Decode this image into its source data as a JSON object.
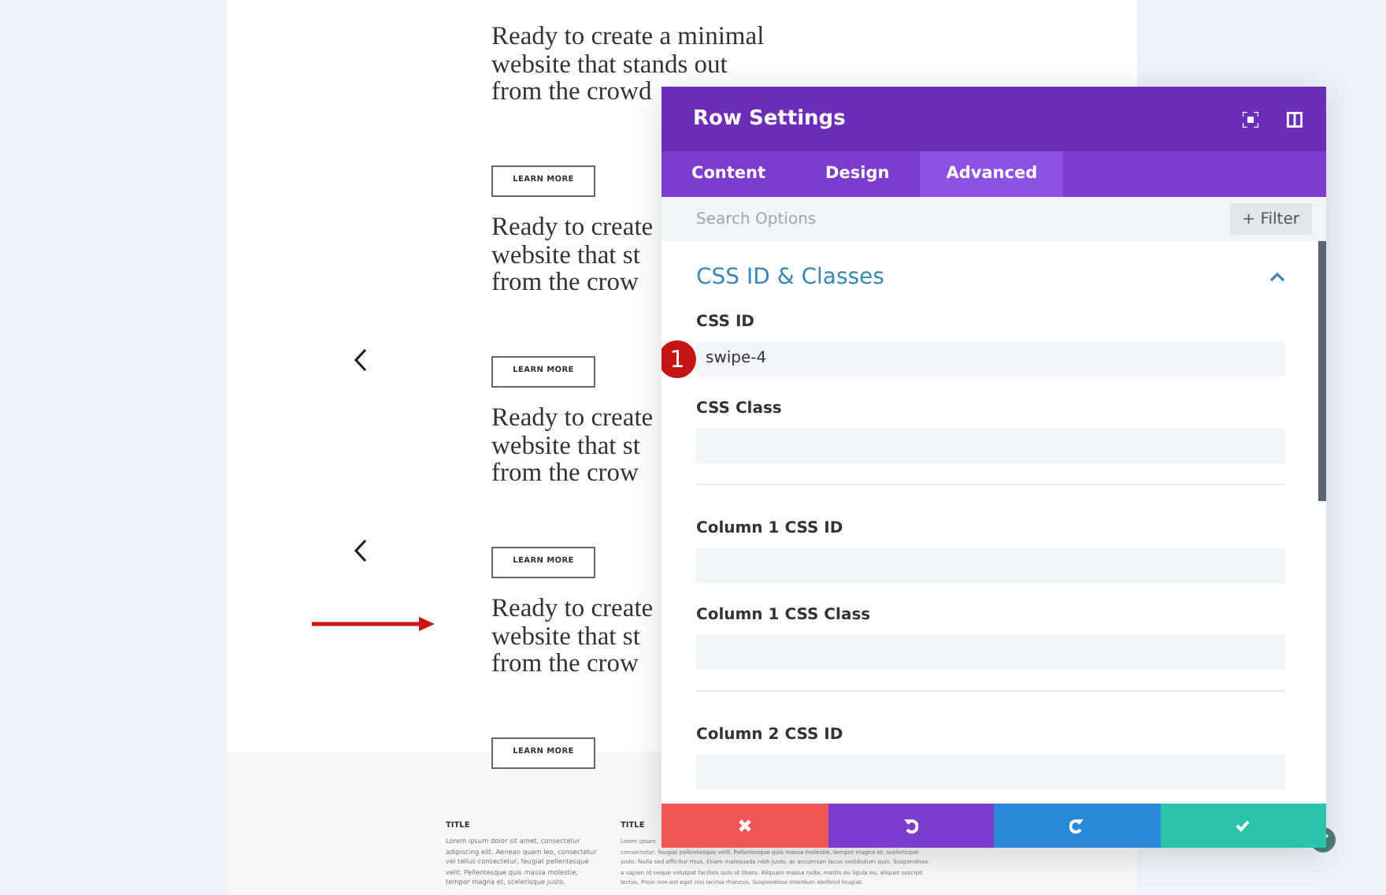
{
  "page": {
    "blocks": [
      {
        "heading": [
          "Ready to create a minimal",
          "website that stands out",
          "from the crowd"
        ],
        "button": "LEARN MORE",
        "prev_arrow": false,
        "pointer": false
      },
      {
        "heading": [
          "Ready to create",
          "website that st",
          "from the crow"
        ],
        "button": "LEARN MORE",
        "prev_arrow": true,
        "pointer": false
      },
      {
        "heading": [
          "Ready to create",
          "website that st",
          "from the crow"
        ],
        "button": "LEARN MORE",
        "prev_arrow": true,
        "pointer": false
      },
      {
        "heading": [
          "Ready to create",
          "website that st",
          "from the crow"
        ],
        "button": "LEARN MORE",
        "prev_arrow": false,
        "pointer": true
      }
    ],
    "footer": [
      {
        "title": "TITLE",
        "text": "Lorem ipsum dolor sit amet, consectetur adipiscing elit. Aenean quam leo, consectetur vel tellus consectetur, feugiat pellentesque velit. Pellentesque quis massa molestie, tempor magna et, scelerisque justo."
      },
      {
        "title": "TITLE",
        "text": "Lorem ipsum",
        "lines": [
          "consectetur, feugiat pellentesque velit. Pellentesque quis massa molestie, tempor magna et, scelerisque",
          "justo. Nulla sed efficitur risus. Etiam malesuada nibh justo, ac accumsan lacus vestibulum quis. Suspendisse",
          "a sapien id neque volutpat facilisis quis ut libero. Aliquam massa nulla, mattis eu ligula eu, aliquet suscipit",
          "lectus. Proin non est eget nisi lacinia rhoncus. Suspendisse interdum eleifend feugiat."
        ]
      }
    ]
  },
  "modal": {
    "title": "Row Settings",
    "tabs": [
      {
        "label": "Content",
        "selected": false
      },
      {
        "label": "Design",
        "selected": false
      },
      {
        "label": "Advanced",
        "selected": true
      }
    ],
    "search": {
      "placeholder": "Search Options"
    },
    "filter": "+ Filter",
    "section": {
      "title": "CSS ID & Classes",
      "expanded": true
    },
    "fields": [
      {
        "label": "CSS ID",
        "value": "swipe-4",
        "marker": "1"
      },
      {
        "label": "CSS Class"
      },
      {
        "label": "Column 1 CSS ID"
      },
      {
        "label": "Column 1 CSS Class"
      },
      {
        "label": "Column 2 CSS ID"
      }
    ],
    "actions": [
      {
        "kind": "cancel"
      },
      {
        "kind": "undo"
      },
      {
        "kind": "redo"
      },
      {
        "kind": "save"
      }
    ]
  }
}
